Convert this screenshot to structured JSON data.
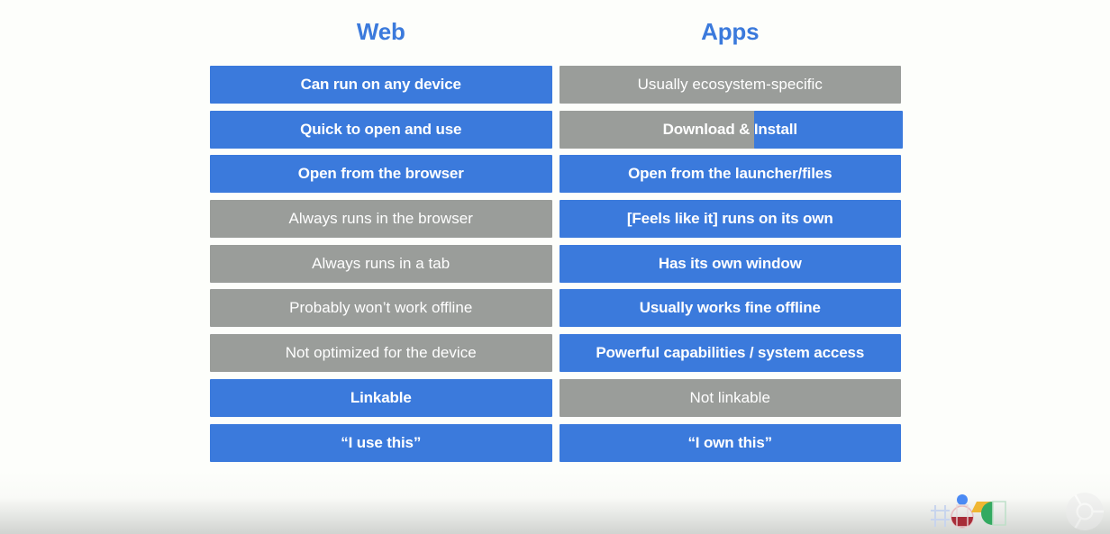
{
  "slide": {
    "title_web": "Web",
    "title_apps": "Apps",
    "accent_blue": "#3b7adc",
    "neutral_gray": "#9a9d9a",
    "background": "#fdfefb",
    "columns": [
      {
        "key": "web",
        "header": "Web"
      },
      {
        "key": "apps",
        "header": "Apps"
      }
    ],
    "rows": [
      {
        "web": {
          "label": "Can run on any device",
          "state": "blue"
        },
        "apps": {
          "label": "Usually ecosystem-specific",
          "state": "gray"
        }
      },
      {
        "web": {
          "label": "Quick to open and use",
          "state": "blue"
        },
        "apps": {
          "label": "Download & Install",
          "state": "split",
          "split_fraction": 0.435
        }
      },
      {
        "web": {
          "label": "Open from the browser",
          "state": "blue"
        },
        "apps": {
          "label": "Open from the launcher/files",
          "state": "blue"
        }
      },
      {
        "web": {
          "label": "Always runs in the browser",
          "state": "gray"
        },
        "apps": {
          "label": "[Feels like it] runs on its own",
          "state": "blue"
        }
      },
      {
        "web": {
          "label": "Always runs in a tab",
          "state": "gray"
        },
        "apps": {
          "label": "Has its own window",
          "state": "blue"
        }
      },
      {
        "web": {
          "label": "Probably won’t work offline",
          "state": "gray"
        },
        "apps": {
          "label": "Usually works fine offline",
          "state": "blue"
        }
      },
      {
        "web": {
          "label": "Not optimized for the device",
          "state": "gray"
        },
        "apps": {
          "label": "Powerful capabilities / system access",
          "state": "blue"
        }
      },
      {
        "web": {
          "label": "Linkable",
          "state": "blue"
        },
        "apps": {
          "label": "Not linkable",
          "state": "gray"
        }
      },
      {
        "web": {
          "label": "“I use this”",
          "state": "blue"
        },
        "apps": {
          "label": "“I own this”",
          "state": "blue"
        }
      }
    ]
  },
  "branding": {
    "io_logo_name": "google-io-logo",
    "chrome_logo_name": "chrome-logo",
    "io_colors": {
      "blue": "#4285f4",
      "red": "#a52430",
      "yellow": "#f0b429",
      "green": "#2aa75a",
      "outline": "#c9d6ef"
    }
  }
}
